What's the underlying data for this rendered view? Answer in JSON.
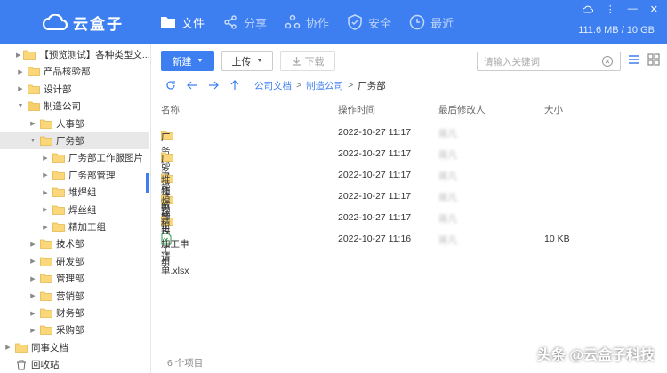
{
  "app": {
    "name": "云盒子",
    "accent": "#3d7ff0"
  },
  "nav": [
    {
      "label": "文件",
      "icon": "folder-icon",
      "active": true
    },
    {
      "label": "分享",
      "icon": "share-icon",
      "active": false
    },
    {
      "label": "协作",
      "icon": "collaborate-icon",
      "active": false
    },
    {
      "label": "安全",
      "icon": "shield-icon",
      "active": false
    },
    {
      "label": "最近",
      "icon": "clock-icon",
      "active": false
    }
  ],
  "storage": "111.6 MB / 10 GB",
  "sidebar": {
    "items": [
      {
        "label": "【预览测试】各种类型文...",
        "indent": 1,
        "arrow": "right",
        "type": "folder"
      },
      {
        "label": "产品核验部",
        "indent": 1,
        "arrow": "right",
        "type": "folder"
      },
      {
        "label": "设计部",
        "indent": 1,
        "arrow": "right",
        "type": "folder"
      },
      {
        "label": "制造公司",
        "indent": 1,
        "arrow": "down",
        "type": "company"
      },
      {
        "label": "人事部",
        "indent": 2,
        "arrow": "right",
        "type": "folder"
      },
      {
        "label": "厂务部",
        "indent": 2,
        "arrow": "down",
        "type": "folder",
        "selected": true
      },
      {
        "label": "厂务部工作服图片",
        "indent": 3,
        "arrow": "right",
        "type": "folder"
      },
      {
        "label": "厂务部管理",
        "indent": 3,
        "arrow": "right",
        "type": "folder"
      },
      {
        "label": "堆焊组",
        "indent": 3,
        "arrow": "right",
        "type": "folder"
      },
      {
        "label": "焊丝组",
        "indent": 3,
        "arrow": "right",
        "type": "folder"
      },
      {
        "label": "精加工组",
        "indent": 3,
        "arrow": "right",
        "type": "folder"
      },
      {
        "label": "技术部",
        "indent": 2,
        "arrow": "right",
        "type": "folder"
      },
      {
        "label": "研发部",
        "indent": 2,
        "arrow": "right",
        "type": "folder"
      },
      {
        "label": "管理部",
        "indent": 2,
        "arrow": "right",
        "type": "folder"
      },
      {
        "label": "营销部",
        "indent": 2,
        "arrow": "right",
        "type": "folder"
      },
      {
        "label": "财务部",
        "indent": 2,
        "arrow": "right",
        "type": "folder"
      },
      {
        "label": "采购部",
        "indent": 2,
        "arrow": "right",
        "type": "folder"
      },
      {
        "label": "同事文档",
        "indent": 0,
        "arrow": "right",
        "type": "folder"
      },
      {
        "label": "回收站",
        "indent": 0,
        "arrow": "",
        "type": "trash"
      }
    ]
  },
  "toolbar": {
    "new": "新建",
    "upload": "上传",
    "download": "下载"
  },
  "search": {
    "placeholder": "请输入关键词"
  },
  "breadcrumb": {
    "items": [
      "公司文档",
      "制造公司",
      "厂务部"
    ]
  },
  "table": {
    "headers": {
      "name": "名称",
      "time": "操作时间",
      "modifier": "最后修改人",
      "size": "大小"
    },
    "rows": [
      {
        "name": "厂务部工作服图片",
        "time": "2022-10-27 11:17",
        "modifier": "蒋凡",
        "size": "",
        "type": "folder"
      },
      {
        "name": "厂务部管理",
        "time": "2022-10-27 11:17",
        "modifier": "蒋凡",
        "size": "",
        "type": "folder"
      },
      {
        "name": "堆焊组",
        "time": "2022-10-27 11:17",
        "modifier": "蒋凡",
        "size": "",
        "type": "folder"
      },
      {
        "name": "焊丝组",
        "time": "2022-10-27 11:17",
        "modifier": "蒋凡",
        "size": "",
        "type": "folder"
      },
      {
        "name": "精加工组",
        "time": "2022-10-27 11:17",
        "modifier": "蒋凡",
        "size": "",
        "type": "folder"
      },
      {
        "name": "加工申请单.xlsx",
        "time": "2022-10-27 11:16",
        "modifier": "蒋凡",
        "size": "10 KB",
        "type": "excel"
      }
    ]
  },
  "footer": {
    "count": "6 个项目"
  },
  "watermark": "头条 @云盒子科技"
}
